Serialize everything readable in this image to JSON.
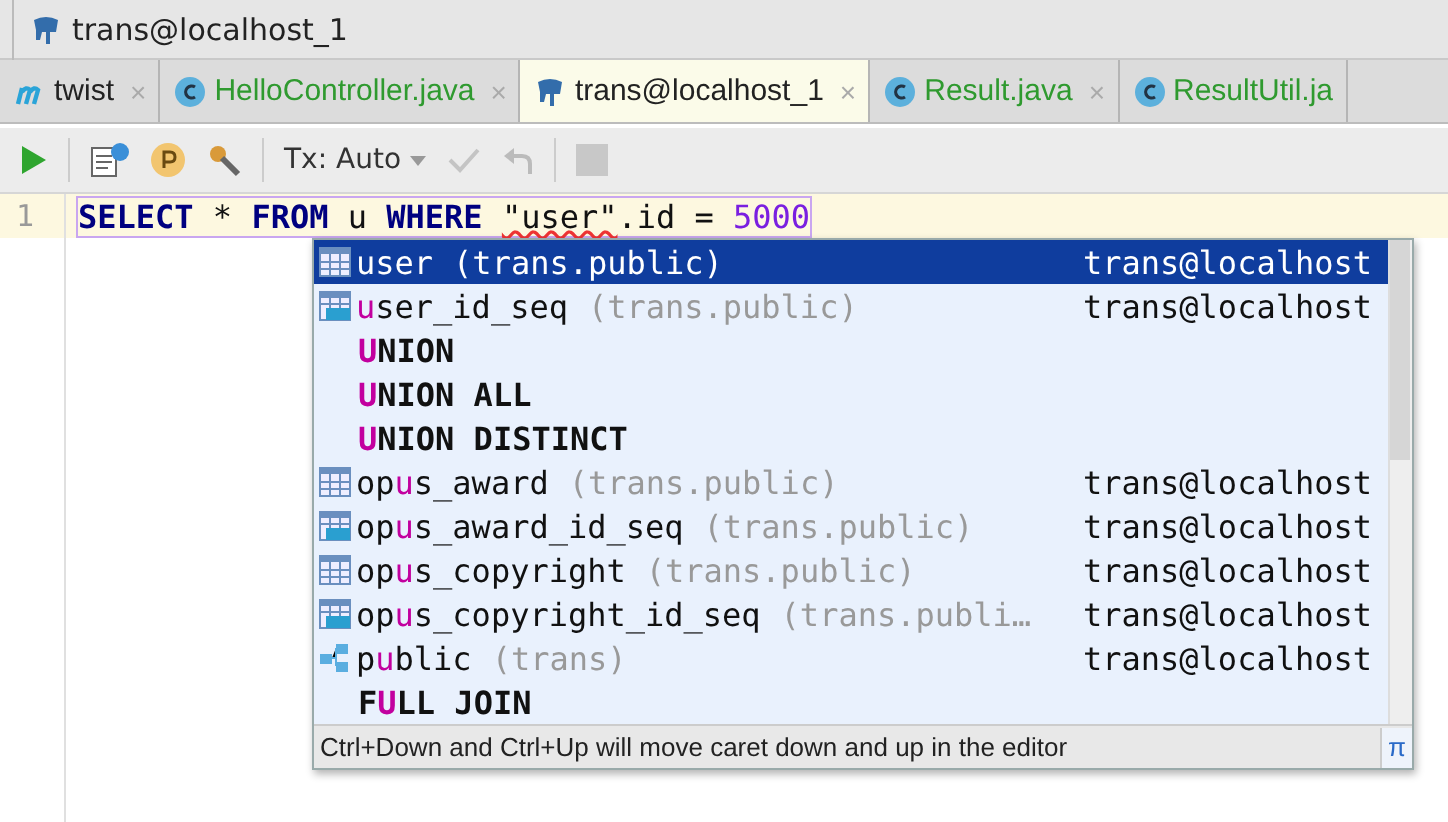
{
  "breadcrumb": {
    "label": "trans@localhost_1"
  },
  "tabs": [
    {
      "label": "twist",
      "kind": "module",
      "selected": false,
      "close": "×"
    },
    {
      "label": "HelloController.java",
      "kind": "class",
      "selected": false,
      "close": "×"
    },
    {
      "label": "trans@localhost_1",
      "kind": "database",
      "selected": true,
      "close": "×"
    },
    {
      "label": "Result.java",
      "kind": "class",
      "selected": false,
      "close": "×"
    },
    {
      "label": "ResultUtil.ja",
      "kind": "class",
      "selected": false
    }
  ],
  "toolbar": {
    "transaction": "Tx: Auto"
  },
  "editor": {
    "line_number": "1",
    "code": [
      {
        "text": "SELECT",
        "kind": "keyword"
      },
      {
        "text": " * ",
        "kind": "plain"
      },
      {
        "text": "FROM",
        "kind": "keyword"
      },
      {
        "text": " u ",
        "kind": "plain"
      },
      {
        "text": "WHERE ",
        "kind": "keyword"
      },
      {
        "text": "\"user\"",
        "kind": "error"
      },
      {
        "text": ".id = ",
        "kind": "plain"
      },
      {
        "text": "5000",
        "kind": "number"
      }
    ]
  },
  "completion": {
    "items": [
      {
        "kind": "table",
        "match": "u",
        "after": "ser",
        "detail": "(trans.public)",
        "source": "trans@localhost",
        "selected": true
      },
      {
        "kind": "sequence",
        "match": "u",
        "after": "ser_id_seq",
        "detail": "(trans.public)",
        "source": "trans@localhost",
        "selected": false
      },
      {
        "kind": "keyword",
        "match": "U",
        "after": "NION",
        "selected": false
      },
      {
        "kind": "keyword",
        "match": "U",
        "after": "NION ALL",
        "selected": false
      },
      {
        "kind": "keyword",
        "match": "U",
        "after": "NION DISTINCT",
        "selected": false
      },
      {
        "kind": "table",
        "before": "op",
        "match": "u",
        "after": "s_award",
        "detail": "(trans.public)",
        "source": "trans@localhost",
        "selected": false
      },
      {
        "kind": "sequence",
        "before": "op",
        "match": "u",
        "after": "s_award_id_seq",
        "detail": "(trans.public)",
        "source": "trans@localhost",
        "selected": false
      },
      {
        "kind": "table",
        "before": "op",
        "match": "u",
        "after": "s_copyright",
        "detail": "(trans.public)",
        "source": "trans@localhost",
        "selected": false
      },
      {
        "kind": "sequence",
        "before": "op",
        "match": "u",
        "after": "s_copyright_id_seq",
        "detail": "(trans.publi…",
        "source": "trans@localhost",
        "selected": false
      },
      {
        "kind": "schema",
        "before": "p",
        "match": "u",
        "after": "blic",
        "detail": "(trans)",
        "source": "trans@localhost",
        "selected": false
      },
      {
        "kind": "keyword",
        "before": "F",
        "match": "U",
        "after": "LL JOIN",
        "selected": false
      }
    ],
    "hint": "Ctrl+Down and Ctrl+Up will move caret down and up in the editor",
    "pi_button": "π"
  }
}
